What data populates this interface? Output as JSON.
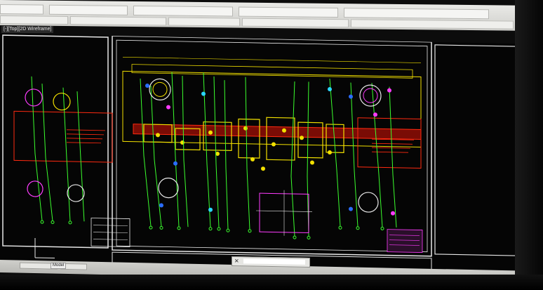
{
  "window": {
    "viewport_tab": "[-][Top][2D Wireframe]",
    "model_tab": "Model"
  },
  "colors": {
    "background": "#050505",
    "frame": "#e8e8e8",
    "wire_green": "#3bff2e",
    "part_yellow": "#f2e000",
    "section_red": "#ff2a10",
    "circle_magenta": "#ff3cff",
    "marker_blue": "#2a6dff",
    "marker_cyan": "#2ad7ff"
  },
  "icons": [
    "close-icon"
  ]
}
